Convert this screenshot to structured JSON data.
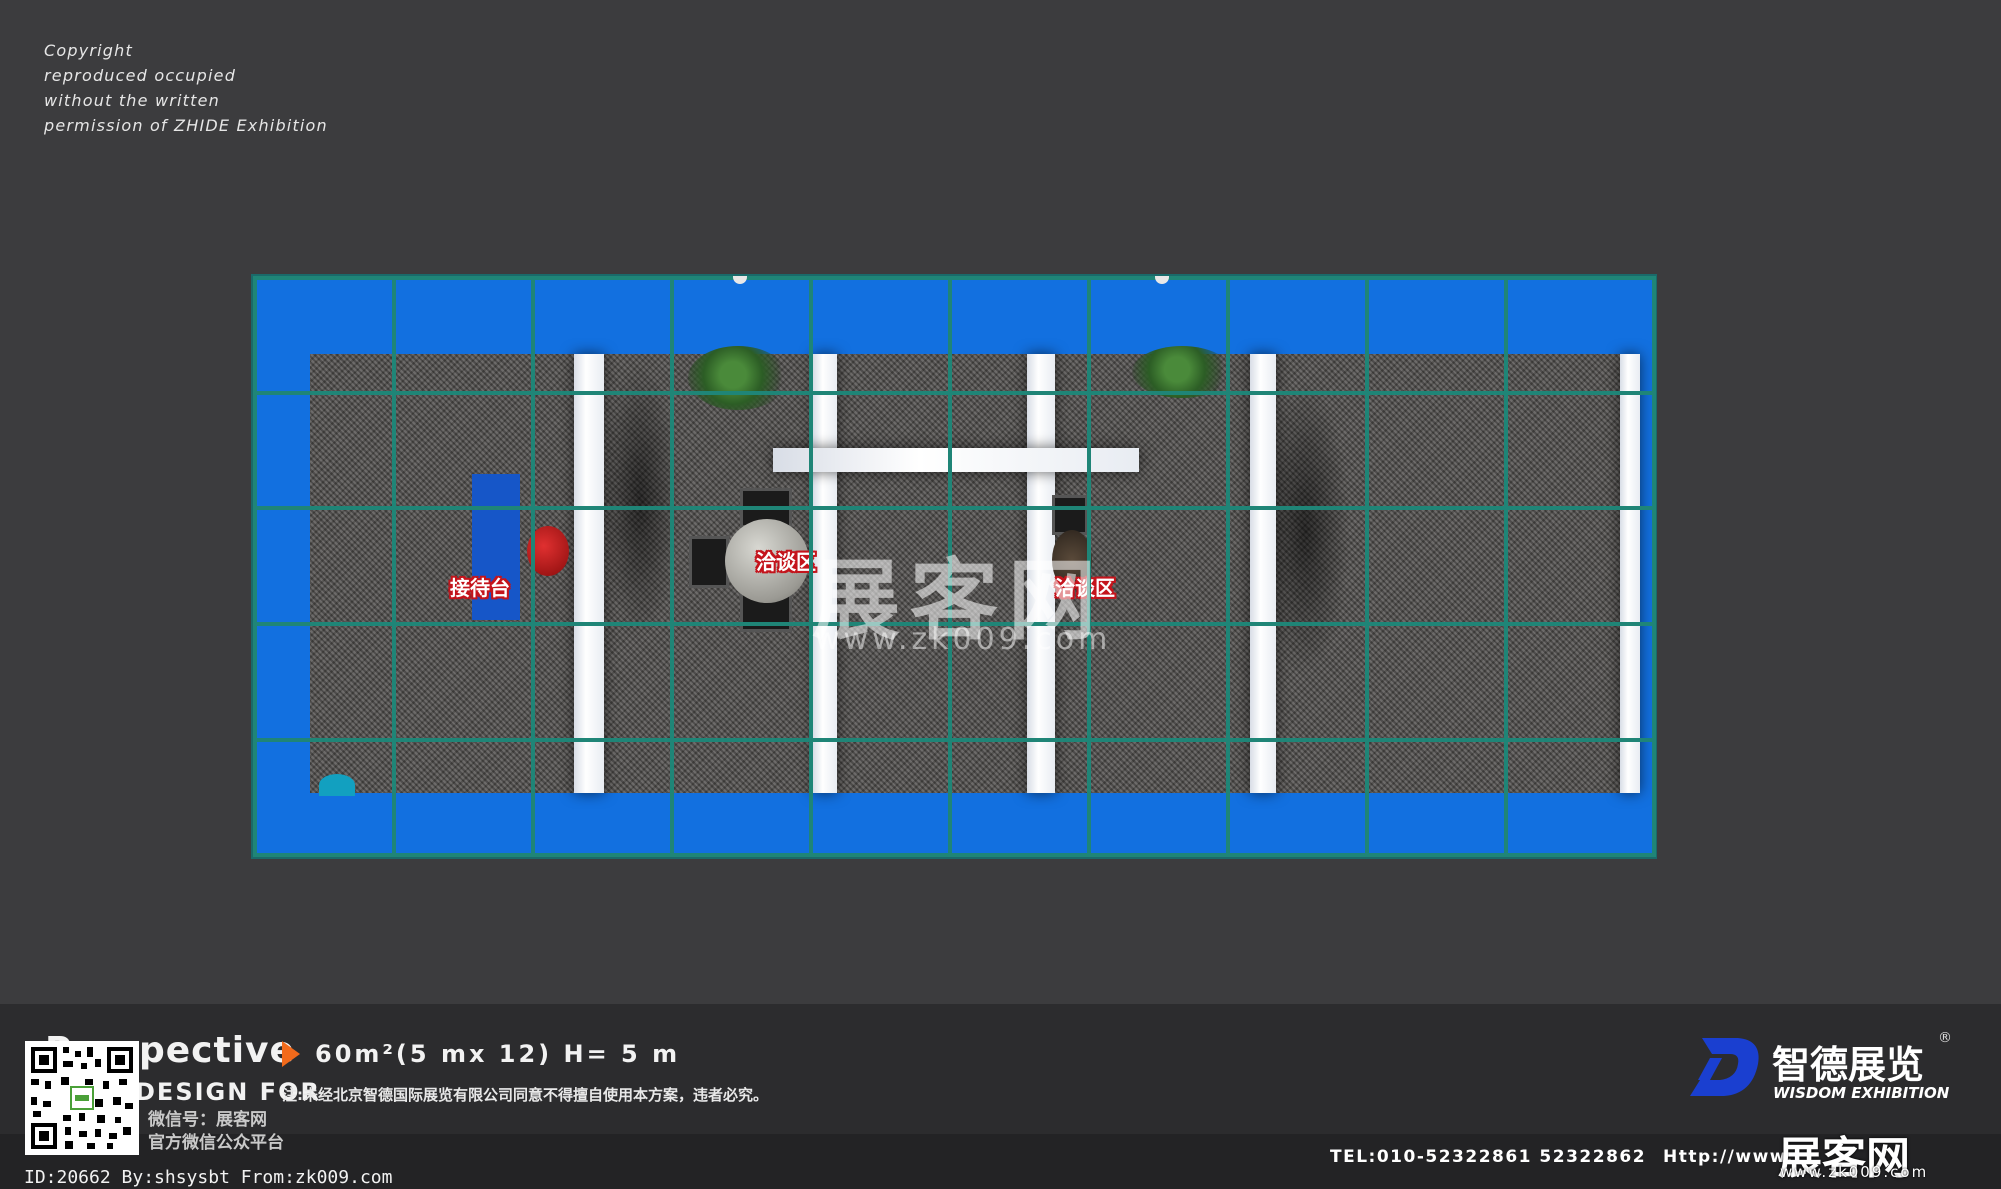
{
  "copyright": {
    "lines": [
      "Copyright",
      "reproduced occupied",
      "without the written",
      "permission of ZHIDE Exhibition"
    ]
  },
  "floorplan": {
    "labels": {
      "reception": "接待台",
      "negotiation_1": "洽谈区",
      "negotiation_2": "洽谈区"
    },
    "colors": {
      "wall": "#1270e0",
      "grid": "#1f8577",
      "label_outline": "#c4141c"
    }
  },
  "watermark": {
    "title": "展客网",
    "url": "www.zk009.com"
  },
  "footer": {
    "perspective": "Perspective",
    "spec": "60m²(5 mx 12) H= 5 m",
    "design_for": "DESIGN FOR",
    "notice": "注:未经北京智德国际展览有限公司同意不得擅自使用本方案，违者必究。",
    "wechat_id": "微信号：展客网",
    "wechat_platform": "官方微信公众平台",
    "id_line": "ID:20662 By:shsysbt From:zk009.com",
    "brand_cn": "智德展览",
    "brand_reg": "®",
    "brand_en": "WISDOM EXHIBITION",
    "tel": "TEL:010-52322861  52322862",
    "http": "Http://www.",
    "corner_watermark": "展客网",
    "corner_url": "www.zk009.com",
    "accent": "#f26a1b",
    "logo_color": "#1a3fd0"
  }
}
